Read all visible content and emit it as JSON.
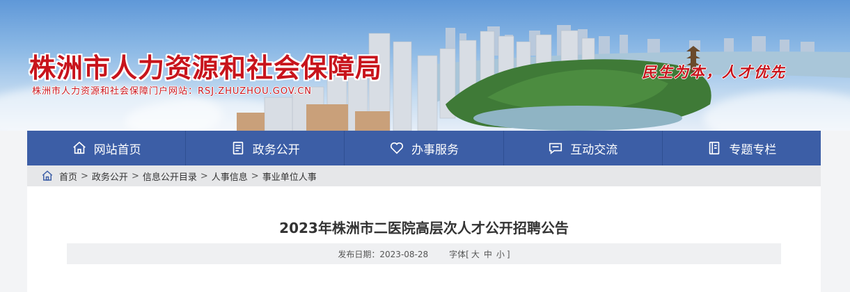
{
  "header": {
    "title": "株洲市人力资源和社会保障局",
    "subtitle": "株洲市人力资源和社会保障门户网站：RSJ.ZHUZHOU.GOV.CN",
    "slogan": "民生为本，人才优先"
  },
  "nav": {
    "items": [
      {
        "label": "网站首页",
        "icon": "home-icon"
      },
      {
        "label": "政务公开",
        "icon": "document-icon"
      },
      {
        "label": "办事服务",
        "icon": "heart-icon"
      },
      {
        "label": "互动交流",
        "icon": "chat-icon"
      },
      {
        "label": "专题专栏",
        "icon": "book-icon"
      }
    ]
  },
  "breadcrumb": {
    "items": [
      "首页",
      "政务公开",
      "信息公开目录",
      "人事信息",
      "事业单位人事"
    ],
    "separator": ">"
  },
  "article": {
    "title": "2023年株洲市二医院高层次人才公开招聘公告",
    "date_label": "发布日期：2023-08-28",
    "font_label": "字体",
    "font_open": "[",
    "font_sizes": [
      "大",
      "中",
      "小"
    ],
    "font_close": "]"
  },
  "colors": {
    "brand_red": "#c8141c",
    "nav_blue": "#3c5ea6",
    "breadcrumb_bg": "#e6e7e9",
    "meta_bg": "#eff0f2"
  }
}
